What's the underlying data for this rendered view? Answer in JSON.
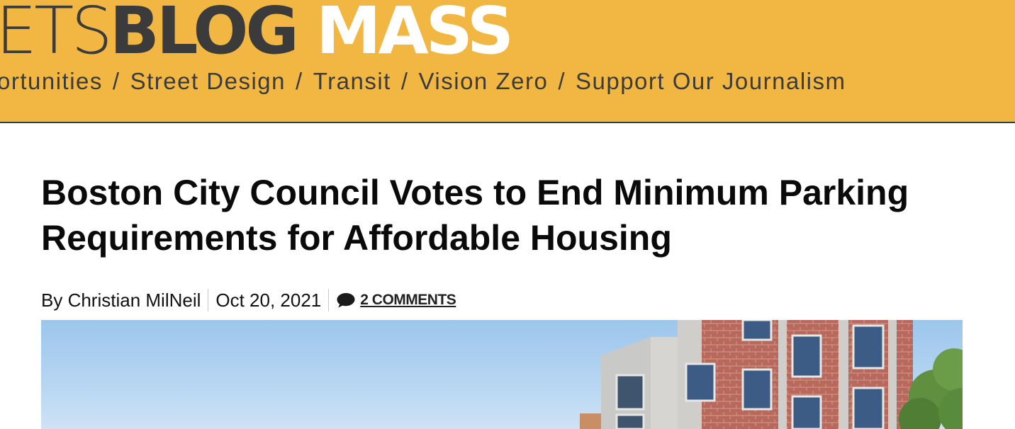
{
  "site": {
    "logo_part1": "ETS",
    "logo_part2": "BLOG",
    "logo_part3": "MASS"
  },
  "nav": {
    "items": [
      {
        "label": "ortunities"
      },
      {
        "label": "Street Design"
      },
      {
        "label": "Transit"
      },
      {
        "label": "Vision Zero"
      },
      {
        "label": "Support Our Journalism"
      }
    ],
    "separator": "/"
  },
  "article": {
    "title_line1": "Boston City Council Votes to End Minimum Parking",
    "title_line2": "Requirements for Affordable Housing",
    "byline": "By Christian MilNeil",
    "date": "Oct 20, 2021",
    "comments": "2 COMMENTS"
  },
  "colors": {
    "masthead": "#f2b742",
    "logo_dark": "#3b3b3b",
    "logo_light": "#ffffff"
  },
  "icons": {
    "comments": "speech-bubble-icon"
  }
}
